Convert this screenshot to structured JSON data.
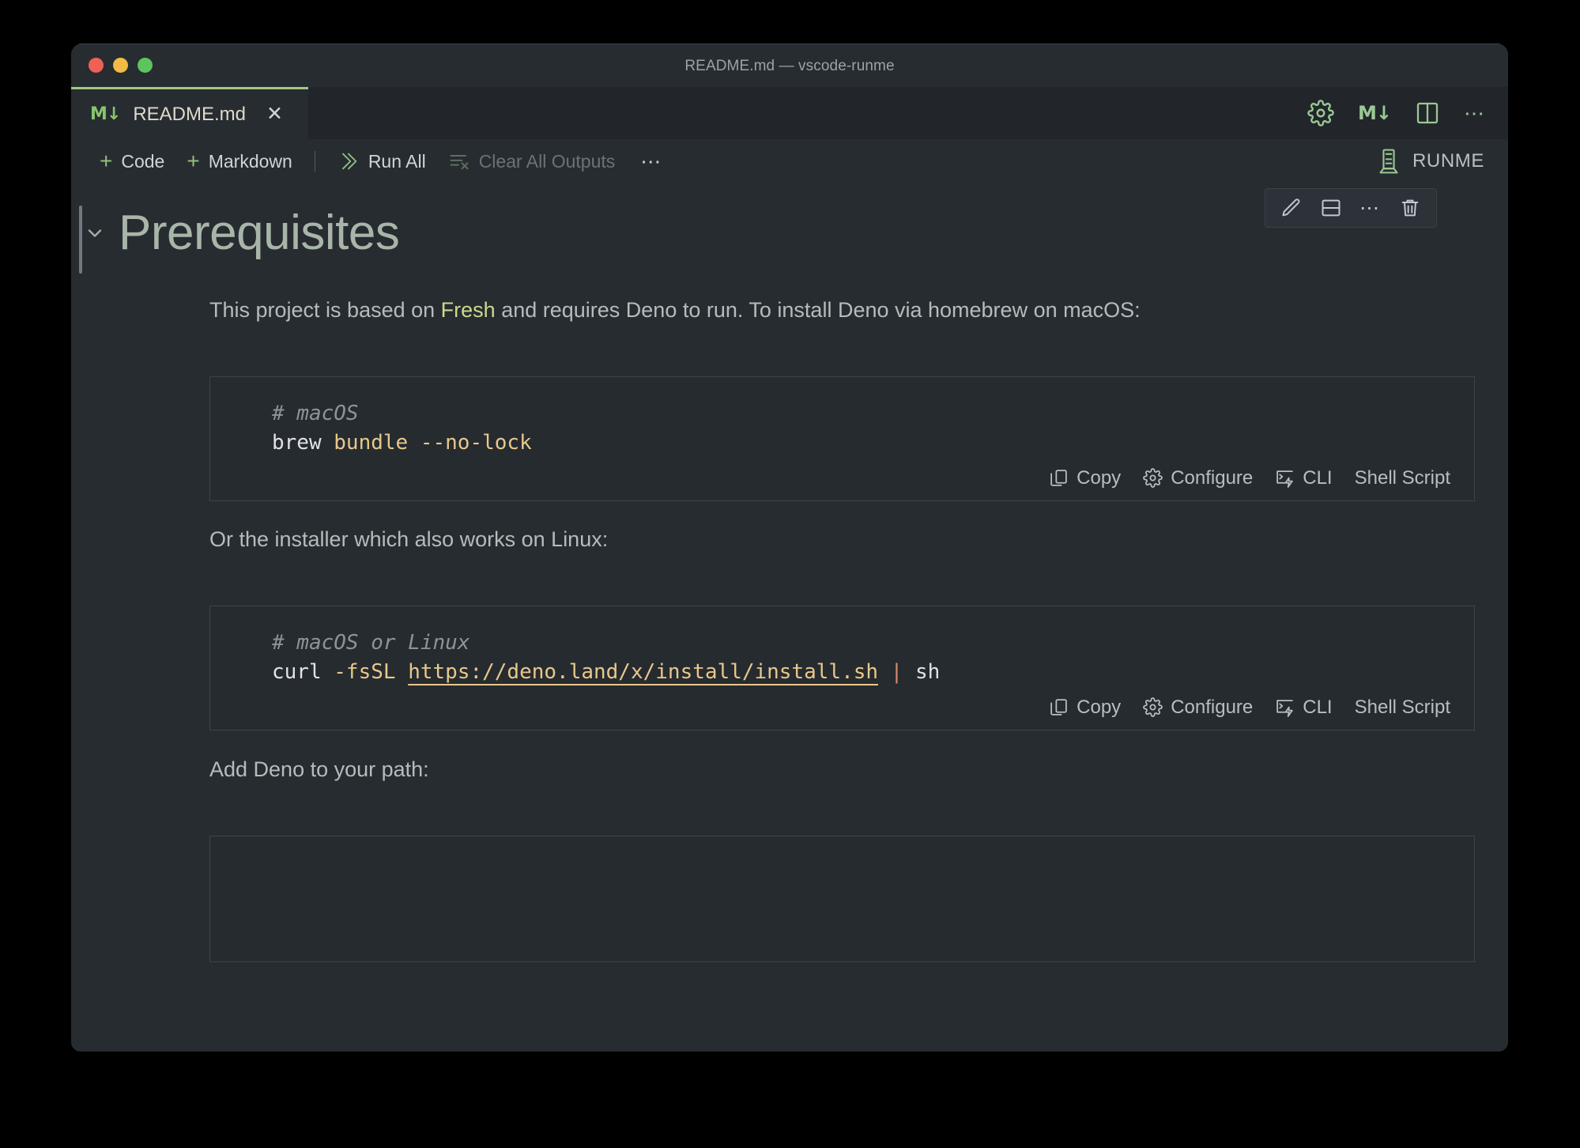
{
  "window": {
    "title": "README.md — vscode-runme",
    "traffic_lights": [
      "close",
      "minimize",
      "zoom"
    ],
    "colors": {
      "close": "#ef6155",
      "minimize": "#f3bb45",
      "zoom": "#5ec45e",
      "accent_green": "#9fc97f",
      "background": "#272c31",
      "link": "#ccd98a"
    }
  },
  "tab": {
    "label": "README.md",
    "icon": "markdown-icon",
    "close_icon": "close-icon",
    "active": true
  },
  "tabbar_actions": [
    {
      "name": "gear-icon",
      "label": ""
    },
    {
      "name": "markdown-preview-icon",
      "label": "M"
    },
    {
      "name": "split-editor-icon",
      "label": ""
    },
    {
      "name": "more-actions-icon",
      "label": "···"
    }
  ],
  "notebook_toolbar": {
    "add_code": "Code",
    "add_markdown": "Markdown",
    "run_all": "Run All",
    "clear_all_outputs": "Clear All Outputs",
    "clear_all_outputs_disabled": true,
    "more": "···",
    "kernel": "RUNME"
  },
  "cell_toolbar": [
    {
      "name": "edit-cell-icon",
      "label": "Edit Cell"
    },
    {
      "name": "split-cell-icon",
      "label": "Split Cell"
    },
    {
      "name": "more-cell-actions-icon",
      "label": "···"
    },
    {
      "name": "delete-cell-icon",
      "label": "Delete Cell"
    }
  ],
  "content": {
    "heading": "Prerequisites",
    "paragraph_1_before": "This project is based on ",
    "paragraph_1_link": "Fresh",
    "paragraph_1_after": " and requires Deno to run. To install Deno via homebrew on macOS:",
    "paragraph_2": "Or the installer which also works on Linux:",
    "paragraph_3": "Add Deno to your path:"
  },
  "code_cells": [
    {
      "comment": "# macOS",
      "command_name": "brew",
      "command_args": " bundle --no-lock",
      "actions": {
        "copy": "Copy",
        "configure": "Configure",
        "cli": "CLI",
        "language": "Shell Script"
      }
    },
    {
      "comment": "# macOS or Linux",
      "command_name": "curl",
      "command_args": " -fsSL ",
      "command_url": "https://deno.land/x/install/install.sh",
      "command_pipe": " | ",
      "command_tail": "sh",
      "actions": {
        "copy": "Copy",
        "configure": "Configure",
        "cli": "CLI",
        "language": "Shell Script"
      }
    }
  ]
}
